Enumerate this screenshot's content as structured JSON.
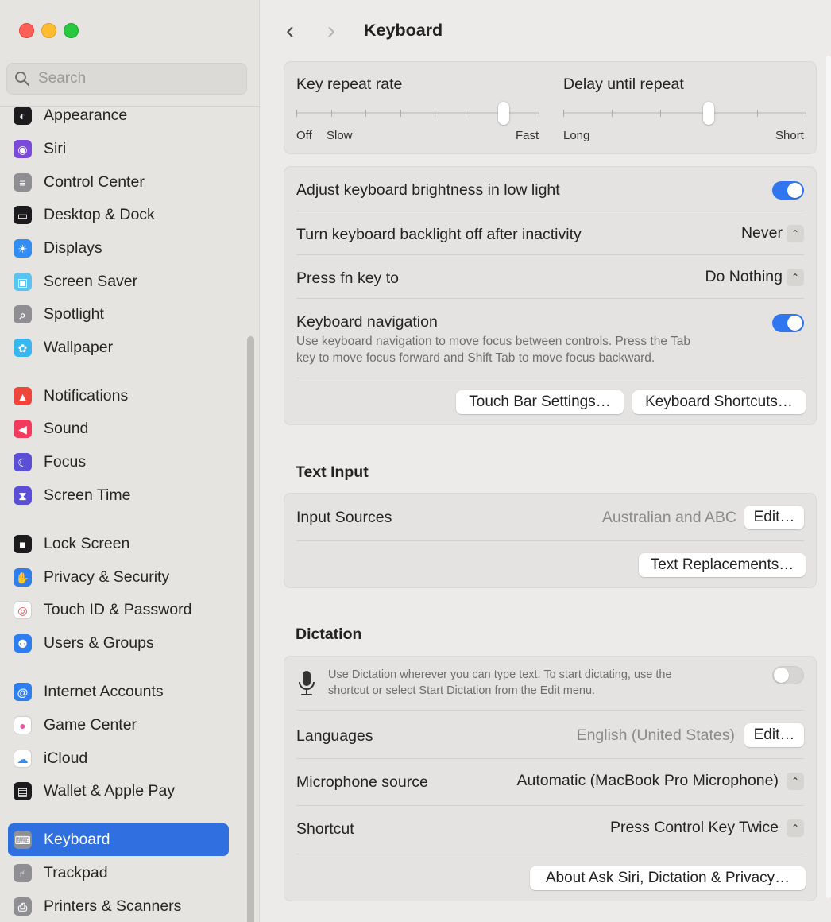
{
  "window": {
    "title": "Keyboard"
  },
  "sidebar": {
    "search_placeholder": "Search",
    "items": [
      {
        "label": "Appearance",
        "icon": "appearance-icon",
        "color": "#1c1c1e"
      },
      {
        "label": "Siri",
        "icon": "siri-icon",
        "color": "#7b4ad9"
      },
      {
        "label": "Control Center",
        "icon": "control-center-icon",
        "color": "#8e8e93"
      },
      {
        "label": "Desktop & Dock",
        "icon": "desktop-dock-icon",
        "color": "#1c1c1e"
      },
      {
        "label": "Displays",
        "icon": "displays-icon",
        "color": "#2f8df5"
      },
      {
        "label": "Screen Saver",
        "icon": "screen-saver-icon",
        "color": "#5ac3f2"
      },
      {
        "label": "Spotlight",
        "icon": "spotlight-icon",
        "color": "#8e8e93"
      },
      {
        "label": "Wallpaper",
        "icon": "wallpaper-icon",
        "color": "#38b6f0"
      },
      {
        "label": "Notifications",
        "icon": "notifications-icon",
        "color": "#f0453a"
      },
      {
        "label": "Sound",
        "icon": "sound-icon",
        "color": "#f03b5c"
      },
      {
        "label": "Focus",
        "icon": "focus-icon",
        "color": "#5a4fd6"
      },
      {
        "label": "Screen Time",
        "icon": "screen-time-icon",
        "color": "#5a4fd6"
      },
      {
        "label": "Lock Screen",
        "icon": "lock-screen-icon",
        "color": "#1c1c1e"
      },
      {
        "label": "Privacy & Security",
        "icon": "privacy-icon",
        "color": "#2f7ef0"
      },
      {
        "label": "Touch ID & Password",
        "icon": "touch-id-icon",
        "color": "#ffffff"
      },
      {
        "label": "Users & Groups",
        "icon": "users-groups-icon",
        "color": "#2f7ef0"
      },
      {
        "label": "Internet Accounts",
        "icon": "internet-accounts-icon",
        "color": "#2f7ef0"
      },
      {
        "label": "Game Center",
        "icon": "game-center-icon",
        "color": "#ffffff"
      },
      {
        "label": "iCloud",
        "icon": "icloud-icon",
        "color": "#ffffff"
      },
      {
        "label": "Wallet & Apple Pay",
        "icon": "wallet-icon",
        "color": "#1c1c1e"
      },
      {
        "label": "Keyboard",
        "icon": "keyboard-icon",
        "color": "#8e8e93",
        "selected": true
      },
      {
        "label": "Trackpad",
        "icon": "trackpad-icon",
        "color": "#8e8e93"
      },
      {
        "label": "Printers & Scanners",
        "icon": "printers-icon",
        "color": "#8e8e93"
      }
    ]
  },
  "key_repeat": {
    "label": "Key repeat rate",
    "min_label_1": "Off",
    "min_label_2": "Slow",
    "max_label": "Fast",
    "ticks": 8,
    "value_index": 6
  },
  "delay_repeat": {
    "label": "Delay until repeat",
    "min_label": "Long",
    "max_label": "Short",
    "ticks": 6,
    "value_index": 3
  },
  "settings": {
    "brightness_label": "Adjust keyboard brightness in low light",
    "brightness_on": true,
    "backlight_label": "Turn keyboard backlight off after inactivity",
    "backlight_value": "Never",
    "fn_label": "Press fn key to",
    "fn_value": "Do Nothing",
    "nav_label": "Keyboard navigation",
    "nav_desc_1": "Use keyboard navigation to move focus between controls. Press the Tab",
    "nav_desc_2": "key to move focus forward and Shift Tab to move focus backward.",
    "nav_on": true,
    "touchbar_button": "Touch Bar Settings…",
    "shortcuts_button": "Keyboard Shortcuts…"
  },
  "text_input": {
    "section_title": "Text Input",
    "input_sources_label": "Input Sources",
    "input_sources_value": "Australian and ABC",
    "edit_button": "Edit…",
    "replacements_button": "Text Replacements…"
  },
  "dictation": {
    "section_title": "Dictation",
    "desc_1": "Use Dictation wherever you can type text. To start dictating, use the",
    "desc_2": "shortcut or select Start Dictation from the Edit menu.",
    "enabled": false,
    "languages_label": "Languages",
    "languages_value": "English (United States)",
    "edit_button": "Edit…",
    "mic_label": "Microphone source",
    "mic_value": "Automatic (MacBook Pro Microphone)",
    "shortcut_label": "Shortcut",
    "shortcut_value": "Press Control Key Twice",
    "about_button": "About Ask Siri, Dictation & Privacy…"
  },
  "colors": {
    "accent": "#2f6fe0",
    "toggle_on": "#2f76f0"
  }
}
